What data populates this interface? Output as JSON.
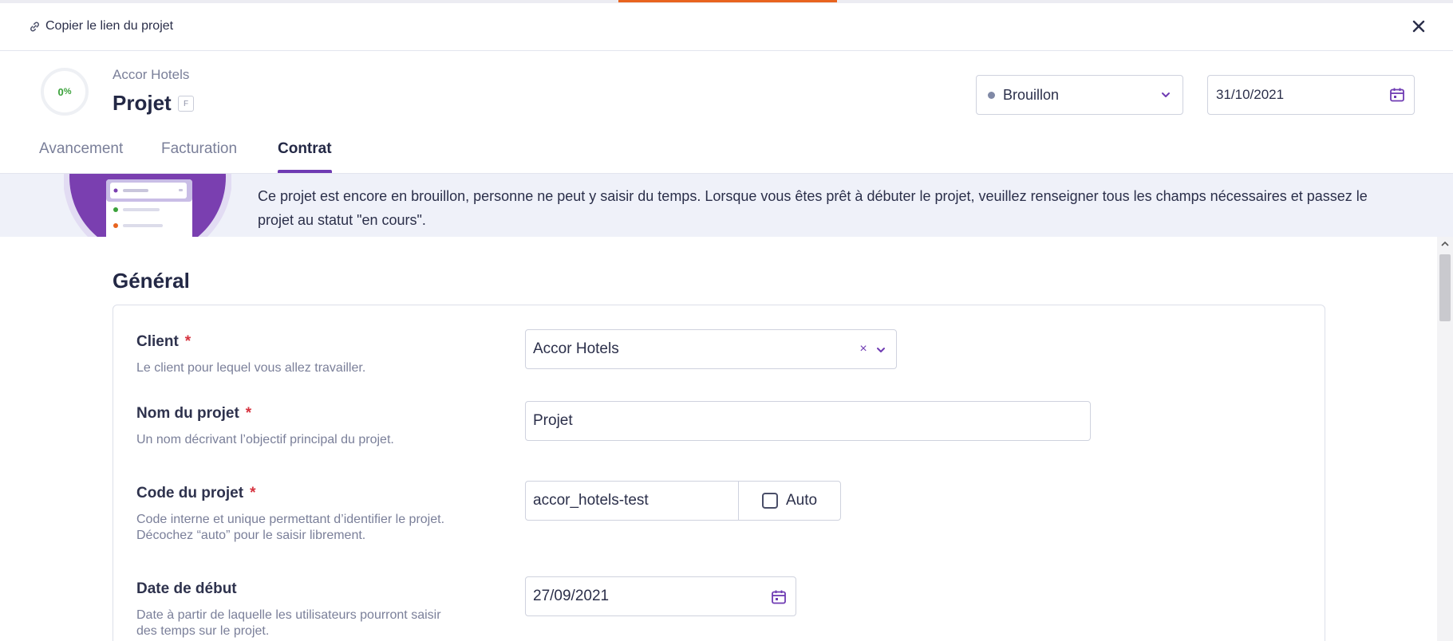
{
  "colors": {
    "accent": "#6f3bb3",
    "progress_text": "#3aa13a",
    "required": "#d6333f",
    "banner_bg": "#eff1f9",
    "status_dot": "#8089a6"
  },
  "linkbar": {
    "copy_link_label": "Copier le lien du projet",
    "link_icon": "link-icon",
    "close_icon": "close-icon"
  },
  "header": {
    "progress": {
      "value": 0,
      "label": "0",
      "unit": "%"
    },
    "client_name": "Accor Hotels",
    "project_name": "Projet",
    "badge": "F",
    "status": {
      "value": "Brouillon",
      "icon": "chevron-down-icon"
    },
    "date": {
      "value": "31/10/2021",
      "icon": "calendar-icon"
    }
  },
  "tabs": [
    {
      "label": "Avancement",
      "active": false
    },
    {
      "label": "Facturation",
      "active": false
    },
    {
      "label": "Contrat",
      "active": true
    }
  ],
  "banner": {
    "text": "Ce projet est encore en brouillon, personne ne peut y saisir du temps. Lorsque vous êtes prêt à débuter le projet, veuillez renseigner tous les champs nécessaires et passez le projet au statut \"en cours\"."
  },
  "general": {
    "title": "Général",
    "fields": {
      "client": {
        "label": "Client",
        "required": "*",
        "help": "Le client pour lequel vous allez travailler.",
        "value": "Accor Hotels",
        "clear_glyph": "×"
      },
      "project_name": {
        "label": "Nom du projet",
        "required": "*",
        "help": "Un nom décrivant l’objectif principal du projet.",
        "value": "Projet"
      },
      "project_code": {
        "label": "Code du projet",
        "required": "*",
        "help_line1": "Code interne et unique permettant d’identifier le projet.",
        "help_line2": "Décochez “auto” pour le saisir librement.",
        "value": "accor_hotels-test",
        "auto_label": "Auto",
        "auto_checked": false
      },
      "start_date": {
        "label": "Date de début",
        "help_line1": "Date à partir de laquelle les utilisateurs pourront saisir",
        "help_line2": "des temps sur le projet.",
        "value": "27/09/2021"
      }
    }
  }
}
